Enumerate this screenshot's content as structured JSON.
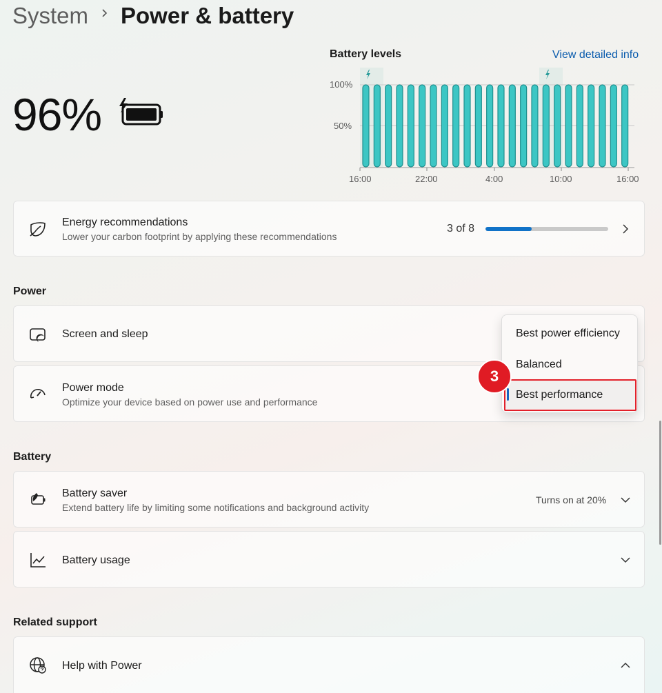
{
  "header": {
    "parent": "System",
    "current": "Power & battery"
  },
  "battery": {
    "percent_text": "96%",
    "charging": true
  },
  "battery_levels": {
    "title": "Battery levels",
    "detail_link": "View detailed info",
    "y_ticks": [
      "100%",
      "50%"
    ],
    "x_ticks": [
      "16:00",
      "22:00",
      "4:00",
      "10:00",
      "16:00"
    ]
  },
  "chart_data": {
    "type": "bar",
    "title": "Battery levels",
    "ylim": [
      0,
      100
    ],
    "y_tick_labels": [
      "100%",
      "50%"
    ],
    "x_tick_labels": [
      "16:00",
      "22:00",
      "4:00",
      "10:00",
      "16:00"
    ],
    "values": [
      100,
      100,
      100,
      100,
      100,
      100,
      100,
      100,
      100,
      100,
      100,
      100,
      100,
      100,
      100,
      100,
      100,
      100,
      100,
      100,
      100,
      100,
      100,
      100
    ],
    "charging_indicators": [
      "16:00",
      "8:00"
    ],
    "bar_color": "#3cc6c4"
  },
  "energy": {
    "title": "Energy recommendations",
    "subtitle": "Lower your carbon footprint by applying these recommendations",
    "progress_text": "3 of 8",
    "progress_fraction": 0.375
  },
  "power_section": {
    "label": "Power",
    "screen_sleep": {
      "title": "Screen and sleep"
    },
    "power_mode": {
      "title": "Power mode",
      "subtitle": "Optimize your device based on power use and performance"
    }
  },
  "power_mode_dropdown": {
    "options": [
      "Best power efficiency",
      "Balanced",
      "Best performance"
    ],
    "selected": "Best performance",
    "step_badge": "3"
  },
  "battery_section": {
    "label": "Battery",
    "saver": {
      "title": "Battery saver",
      "subtitle": "Extend battery life by limiting some notifications and background activity",
      "status": "Turns on at 20%"
    },
    "usage": {
      "title": "Battery usage"
    }
  },
  "support_section": {
    "label": "Related support",
    "help": {
      "title": "Help with Power"
    }
  },
  "colors": {
    "accent": "#1072c8",
    "link": "#0b5cad",
    "highlight": "#e2202a",
    "bar": "#3cc6c4"
  }
}
